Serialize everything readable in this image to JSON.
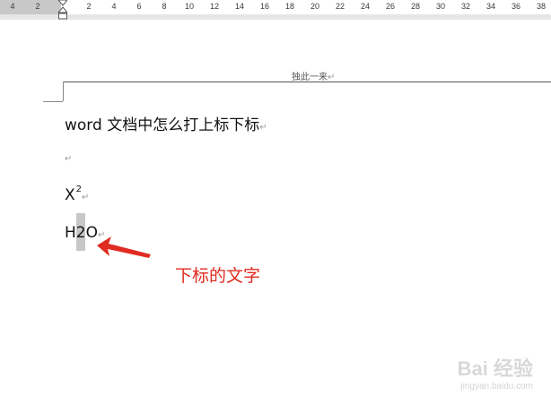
{
  "ruler": {
    "left_numbers": [
      "4",
      "2"
    ],
    "right_numbers": [
      "2",
      "4",
      "6",
      "8",
      "10",
      "12",
      "14",
      "16",
      "18",
      "20",
      "22",
      "24",
      "26",
      "28",
      "30",
      "32",
      "34",
      "36",
      "38"
    ]
  },
  "header": {
    "text": "独此一来",
    "mark": "↵"
  },
  "document": {
    "title": "word 文档中怎么打上标下标",
    "title_mark": "↵",
    "empty_mark": "↵",
    "superscript": {
      "base": "X",
      "sup": "2",
      "mark": "↵"
    },
    "subscript": {
      "text": "H2O",
      "mark": "↵"
    }
  },
  "annotation": {
    "text": "下标的文字",
    "color": "#e02b20"
  },
  "watermark": {
    "main": "Bai 经验",
    "sub": "jingyan.baidu.com"
  }
}
